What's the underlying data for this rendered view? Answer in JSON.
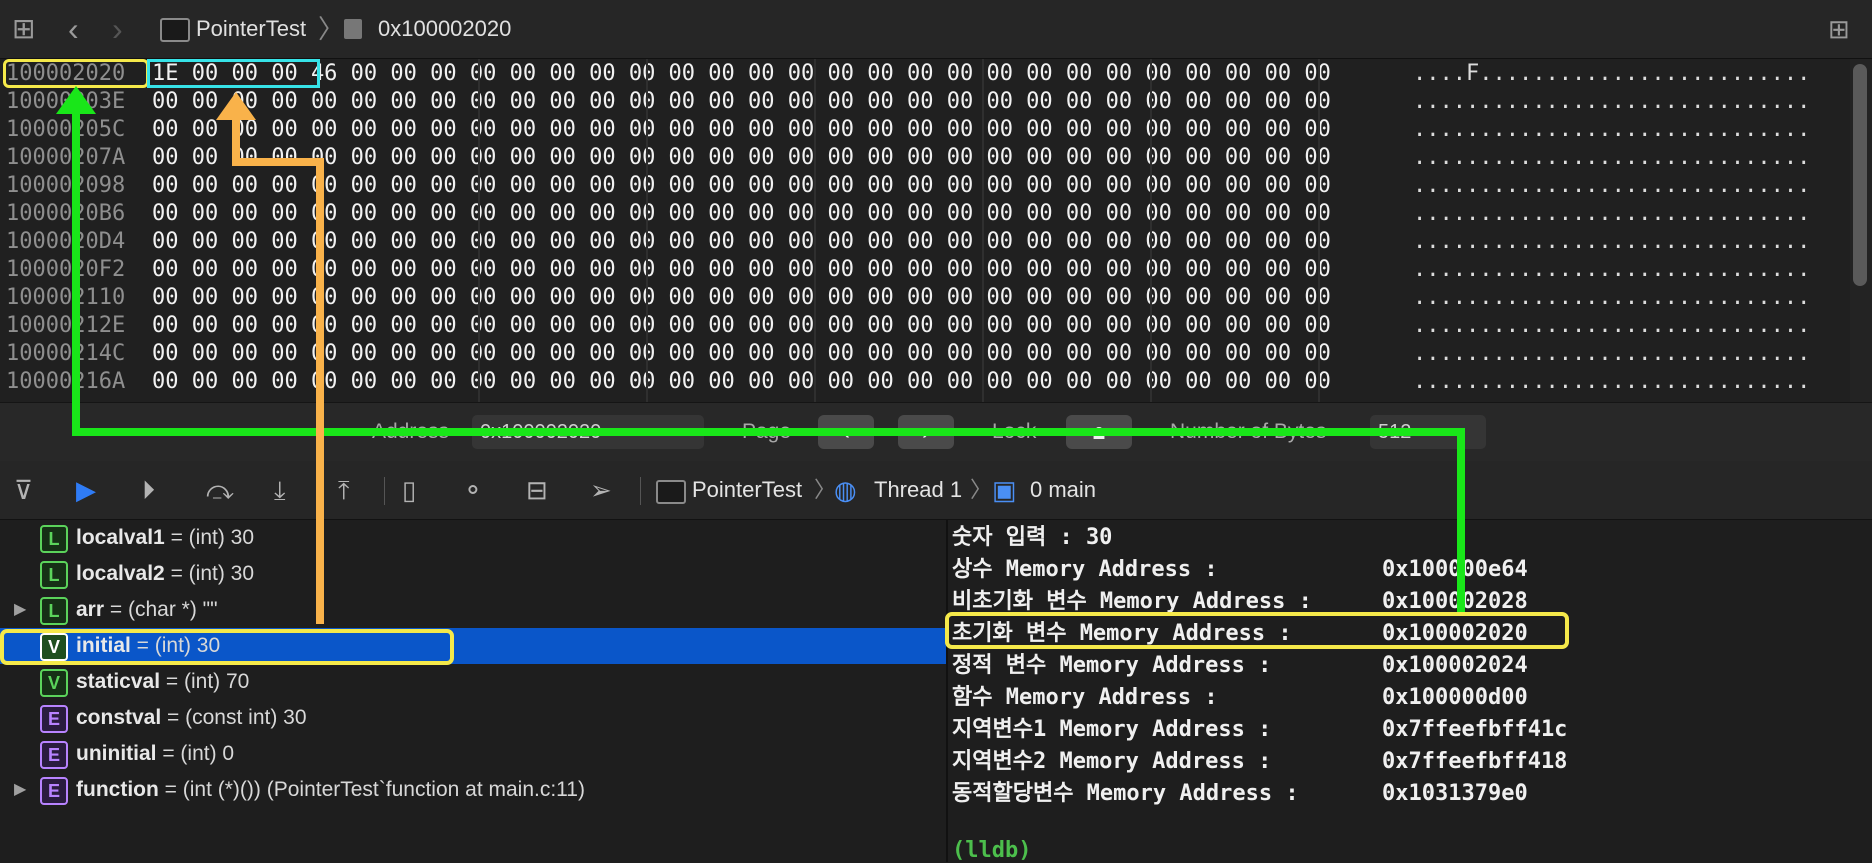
{
  "nav": {
    "breadcrumb_project": "PointerTest",
    "breadcrumb_address": "0x100002020"
  },
  "memory": {
    "rows": [
      {
        "addr": "100002020",
        "bytes": "1E 00 00 00 46 00 00 00 00 00 00 00 00 00 00 00 00 00 00 00 00 00 00 00 00 00 00 00 00 00",
        "ascii": "....F........................."
      },
      {
        "addr": "10000203E",
        "bytes": "00 00 00 00 00 00 00 00 00 00 00 00 00 00 00 00 00 00 00 00 00 00 00 00 00 00 00 00 00 00",
        "ascii": ".............................."
      },
      {
        "addr": "10000205C",
        "bytes": "00 00 00 00 00 00 00 00 00 00 00 00 00 00 00 00 00 00 00 00 00 00 00 00 00 00 00 00 00 00",
        "ascii": ".............................."
      },
      {
        "addr": "10000207A",
        "bytes": "00 00 00 00 00 00 00 00 00 00 00 00 00 00 00 00 00 00 00 00 00 00 00 00 00 00 00 00 00 00",
        "ascii": ".............................."
      },
      {
        "addr": "100002098",
        "bytes": "00 00 00 00 00 00 00 00 00 00 00 00 00 00 00 00 00 00 00 00 00 00 00 00 00 00 00 00 00 00",
        "ascii": ".............................."
      },
      {
        "addr": "1000020B6",
        "bytes": "00 00 00 00 00 00 00 00 00 00 00 00 00 00 00 00 00 00 00 00 00 00 00 00 00 00 00 00 00 00",
        "ascii": ".............................."
      },
      {
        "addr": "1000020D4",
        "bytes": "00 00 00 00 00 00 00 00 00 00 00 00 00 00 00 00 00 00 00 00 00 00 00 00 00 00 00 00 00 00",
        "ascii": ".............................."
      },
      {
        "addr": "1000020F2",
        "bytes": "00 00 00 00 00 00 00 00 00 00 00 00 00 00 00 00 00 00 00 00 00 00 00 00 00 00 00 00 00 00",
        "ascii": ".............................."
      },
      {
        "addr": "100002110",
        "bytes": "00 00 00 00 00 00 00 00 00 00 00 00 00 00 00 00 00 00 00 00 00 00 00 00 00 00 00 00 00 00",
        "ascii": ".............................."
      },
      {
        "addr": "10000212E",
        "bytes": "00 00 00 00 00 00 00 00 00 00 00 00 00 00 00 00 00 00 00 00 00 00 00 00 00 00 00 00 00 00",
        "ascii": ".............................."
      },
      {
        "addr": "10000214C",
        "bytes": "00 00 00 00 00 00 00 00 00 00 00 00 00 00 00 00 00 00 00 00 00 00 00 00 00 00 00 00 00 00",
        "ascii": ".............................."
      },
      {
        "addr": "10000216A",
        "bytes": "00 00 00 00 00 00 00 00 00 00 00 00 00 00 00 00 00 00 00 00 00 00 00 00 00 00 00 00 00 00",
        "ascii": ".............................."
      }
    ]
  },
  "memfooter": {
    "address_label": "Address",
    "address_value": "0x100002020",
    "page_label": "Page",
    "lock_label": "Lock",
    "bytes_label": "Number of Bytes",
    "bytes_value": "512"
  },
  "debugbar": {
    "process": "PointerTest",
    "thread": "Thread 1",
    "frame": "0 main"
  },
  "variables": [
    {
      "kind": "L",
      "name": "localval1",
      "rest": " = (int) 30",
      "expand": false
    },
    {
      "kind": "L",
      "name": "localval2",
      "rest": " = (int) 30",
      "expand": false
    },
    {
      "kind": "L",
      "name": "arr",
      "rest": " = (char *) \"\"",
      "expand": true
    },
    {
      "kind": "V",
      "name": "initial",
      "rest": " = (int) 30",
      "expand": false,
      "selected": true
    },
    {
      "kind": "V",
      "name": "staticval",
      "rest": " = (int) 70",
      "expand": false
    },
    {
      "kind": "E",
      "name": "constval",
      "rest": " = (const int) 30",
      "expand": false
    },
    {
      "kind": "E",
      "name": "uninitial",
      "rest": " = (int) 0",
      "expand": false
    },
    {
      "kind": "E",
      "name": "function",
      "rest": " = (int (*)()) (PointerTest`function at main.c:11)",
      "expand": true
    }
  ],
  "console": {
    "lines": [
      {
        "label": "숫자 입력 : 30",
        "value": ""
      },
      {
        "label": "상수 Memory Address :",
        "value": "0x100000e64"
      },
      {
        "label": "비초기화 변수 Memory Address :",
        "value": "0x100002028"
      },
      {
        "label": "초기화 변수 Memory Address :",
        "value": "0x100002020"
      },
      {
        "label": "정적 변수 Memory Address :",
        "value": "0x100002024"
      },
      {
        "label": "함수 Memory Address :",
        "value": "0x100000d00"
      },
      {
        "label": "지역변수1 Memory Address :",
        "value": "0x7ffeefbff41c"
      },
      {
        "label": "지역변수2 Memory Address :",
        "value": "0x7ffeefbff418"
      },
      {
        "label": "동적할당변수 Memory Address :",
        "value": "0x1031379e0"
      }
    ],
    "prompt": "(lldb)"
  },
  "colors": {
    "highlight_yellow": "#f5e94a",
    "highlight_cyan": "#37e3e8",
    "arrow_green": "#19e619",
    "arrow_orange": "#f9b24a",
    "selection_blue": "#0a56c9"
  }
}
